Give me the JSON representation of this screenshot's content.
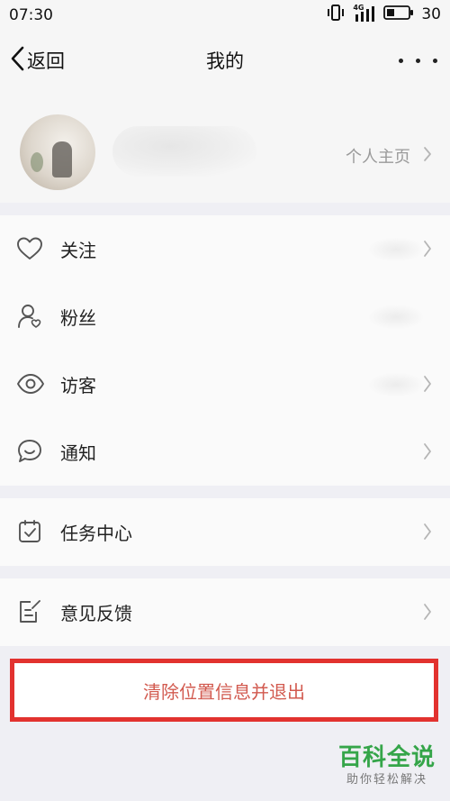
{
  "status_bar": {
    "time": "07:30",
    "network": "4G",
    "battery": "30"
  },
  "nav": {
    "back_label": "返回",
    "title": "我的"
  },
  "profile": {
    "homepage_label": "个人主页"
  },
  "menu_group_1": [
    {
      "label": "关注",
      "icon": "heart-icon"
    },
    {
      "label": "粉丝",
      "icon": "fans-icon"
    },
    {
      "label": "访客",
      "icon": "eye-icon"
    },
    {
      "label": "通知",
      "icon": "chat-bubble-icon"
    }
  ],
  "menu_group_2": [
    {
      "label": "任务中心",
      "icon": "task-check-icon"
    }
  ],
  "menu_group_3": [
    {
      "label": "意见反馈",
      "icon": "feedback-edit-icon"
    }
  ],
  "exit_button": {
    "label": "清除位置信息并退出",
    "highlight_color": "#e2322f"
  },
  "watermark": {
    "title": "百科全说",
    "subtitle": "助你轻松解决",
    "color": "#35a549"
  }
}
